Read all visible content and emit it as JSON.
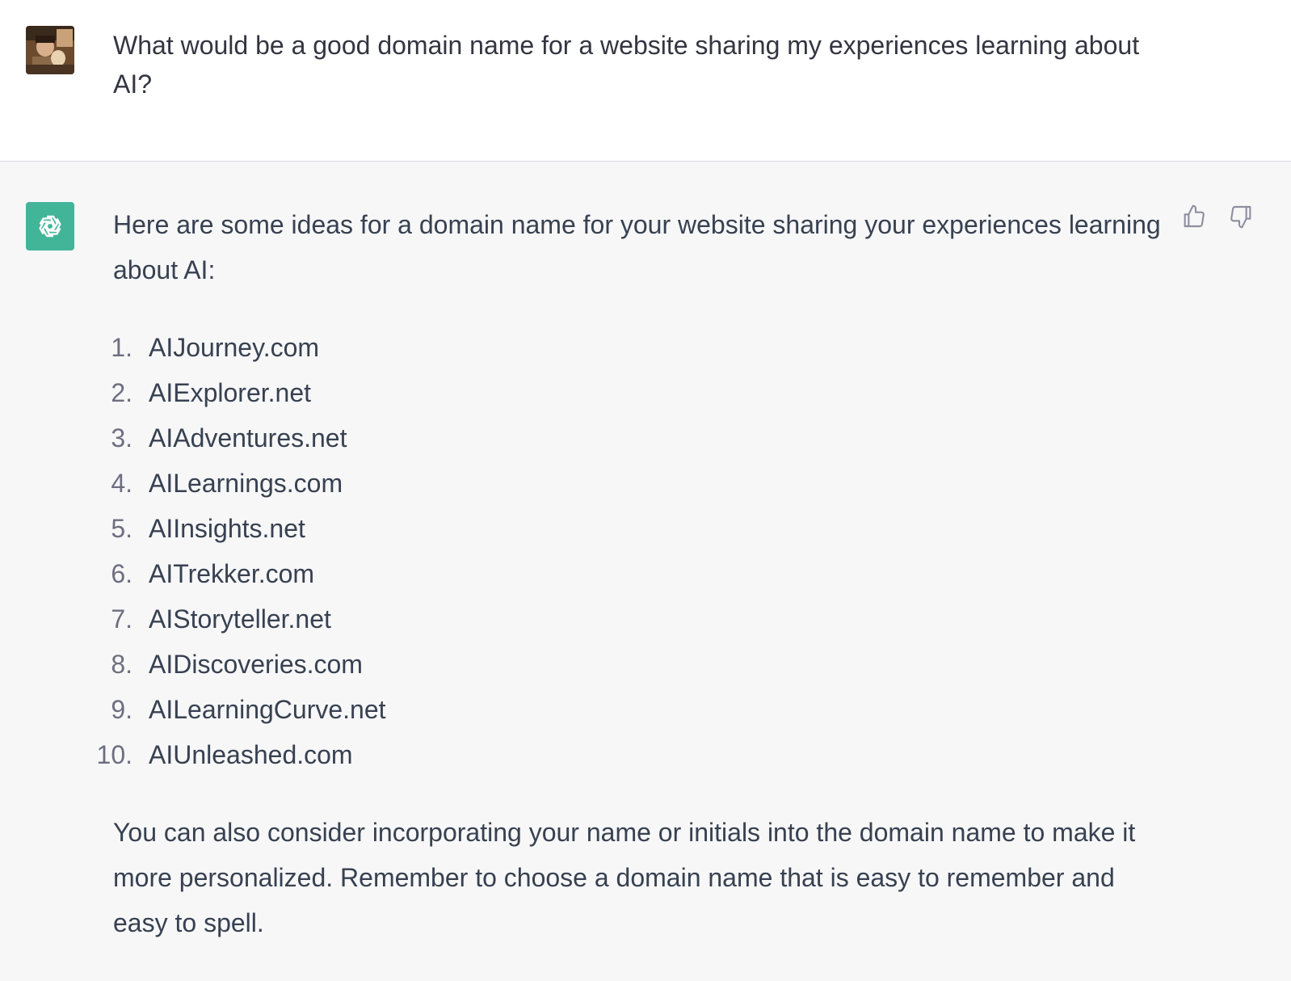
{
  "conversation": {
    "user_message": "What would be a good domain name for a website sharing my experiences learning about AI?",
    "assistant": {
      "intro": "Here are some ideas for a domain name for your website sharing your experiences learning about AI:",
      "domains": [
        {
          "num": "1.",
          "name": "AIJourney.com"
        },
        {
          "num": "2.",
          "name": "AIExplorer.net"
        },
        {
          "num": "3.",
          "name": "AIAdventures.net"
        },
        {
          "num": "4.",
          "name": "AILearnings.com"
        },
        {
          "num": "5.",
          "name": "AIInsights.net"
        },
        {
          "num": "6.",
          "name": "AITrekker.com"
        },
        {
          "num": "7.",
          "name": "AIStoryteller.net"
        },
        {
          "num": "8.",
          "name": "AIDiscoveries.com"
        },
        {
          "num": "9.",
          "name": "AILearningCurve.net"
        },
        {
          "num": "10.",
          "name": "AIUnleashed.com"
        }
      ],
      "closing": "You can also consider incorporating your name or initials into the domain name to make it more personalized. Remember to choose a domain name that is easy to remember and easy to spell."
    }
  },
  "icons": {
    "user_avatar": "user-photo-avatar",
    "assistant_avatar": "openai-logo-icon",
    "thumbs_up": "thumbs-up-icon",
    "thumbs_down": "thumbs-down-icon"
  },
  "colors": {
    "assistant_bg": "#f7f7f8",
    "assistant_avatar_bg": "#10a37f",
    "text": "#343541"
  }
}
